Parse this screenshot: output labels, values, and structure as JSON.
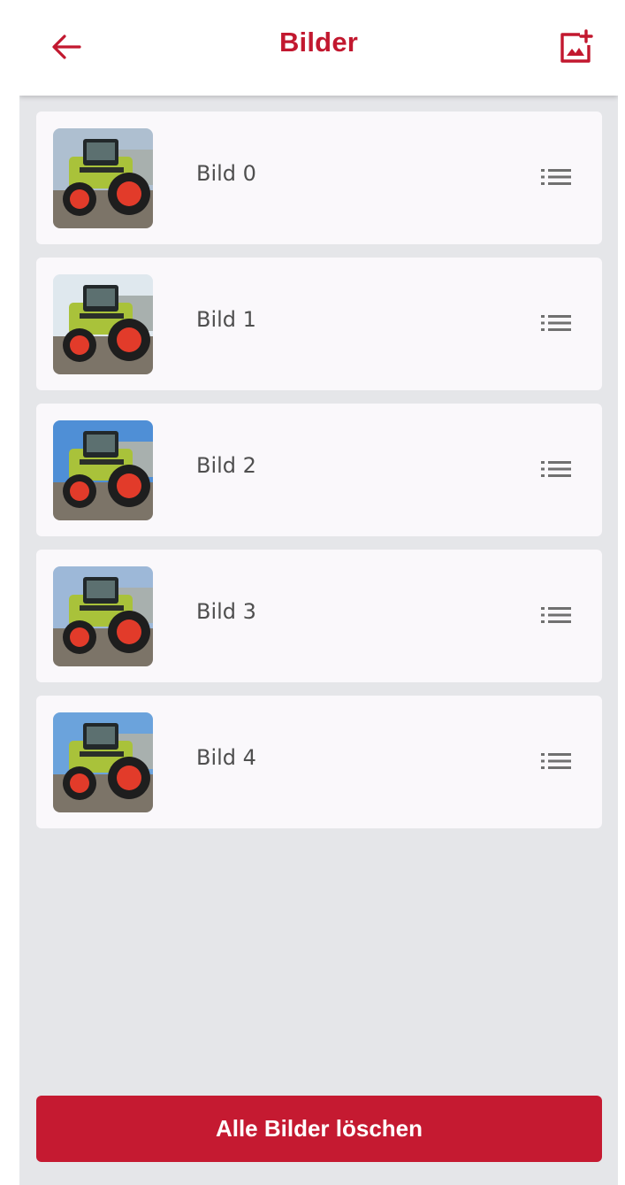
{
  "header": {
    "title": "Bilder",
    "back_icon": "arrow-left-icon",
    "add_icon": "add-photo-icon"
  },
  "colors": {
    "accent": "#c2182f",
    "background": "#e5e6e9",
    "card": "#faf8fb"
  },
  "items": [
    {
      "label": "Bild 0",
      "thumbnail_icon": "tractor-photo",
      "menu_icon": "list-icon"
    },
    {
      "label": "Bild 1",
      "thumbnail_icon": "tractor-photo",
      "menu_icon": "list-icon"
    },
    {
      "label": "Bild 2",
      "thumbnail_icon": "tractor-photo",
      "menu_icon": "list-icon"
    },
    {
      "label": "Bild 3",
      "thumbnail_icon": "tractor-photo",
      "menu_icon": "list-icon"
    },
    {
      "label": "Bild 4",
      "thumbnail_icon": "tractor-photo",
      "menu_icon": "list-icon"
    }
  ],
  "footer": {
    "delete_all_label": "Alle Bilder löschen"
  }
}
